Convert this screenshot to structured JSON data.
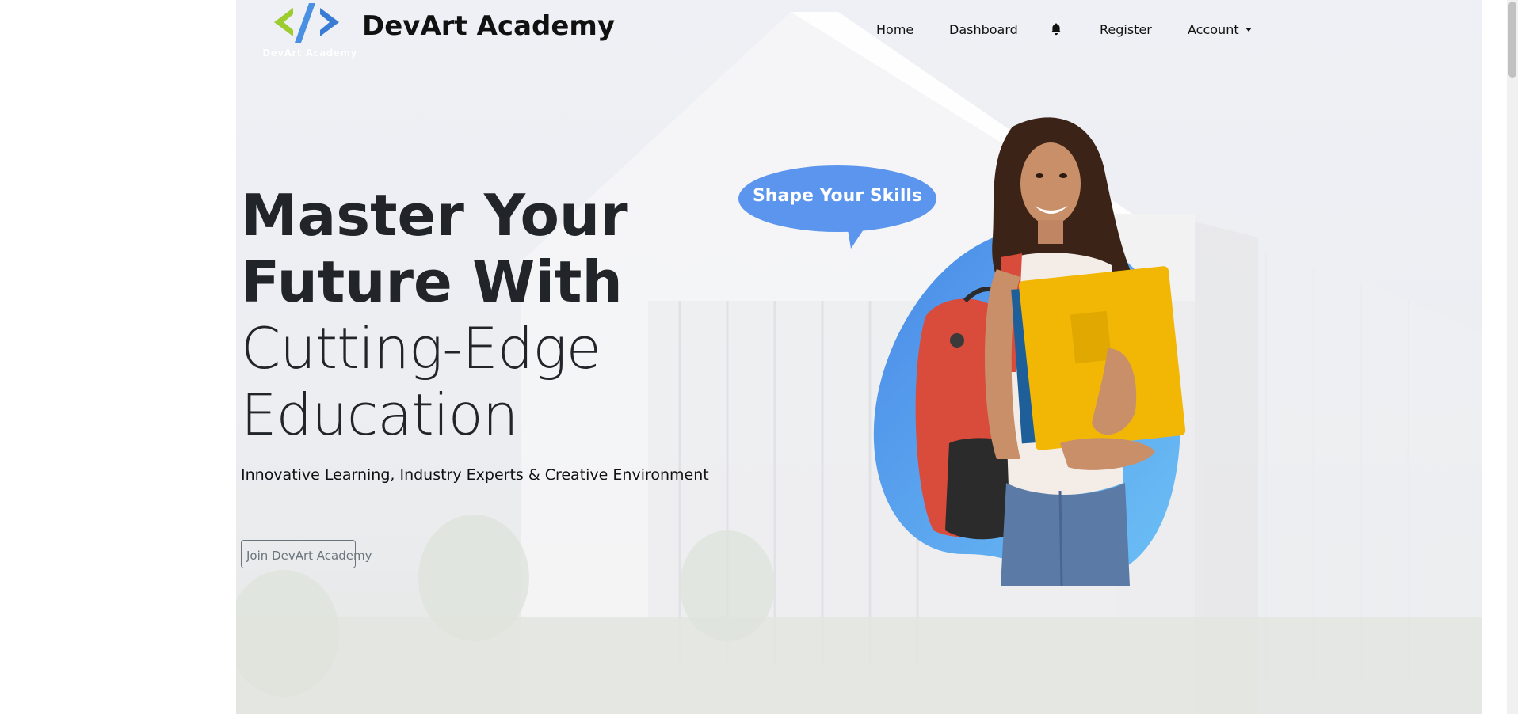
{
  "brand": {
    "name": "DevArt Academy",
    "logo_caption": "DevArt Academy",
    "logo_glyph": "</>"
  },
  "nav": {
    "home": "Home",
    "dashboard": "Dashboard",
    "register": "Register",
    "account": "Account",
    "icons": [
      "bell-icon",
      "caret-down-icon"
    ]
  },
  "hero": {
    "line1": "Master Your",
    "line2": "Future With",
    "line3": "Cutting-Edge",
    "line4": "Education",
    "subtitle": "Innovative Learning, Industry Experts & Creative Environment",
    "cta": "Join DevArt Academy"
  },
  "illustration": {
    "bubble_text": "Shape Your Skills"
  },
  "colors": {
    "accent_blue": "#5b95ee",
    "blob_blue": "#4a90e2",
    "folder_yellow": "#f2b705",
    "backpack_red": "#d94b3a"
  }
}
